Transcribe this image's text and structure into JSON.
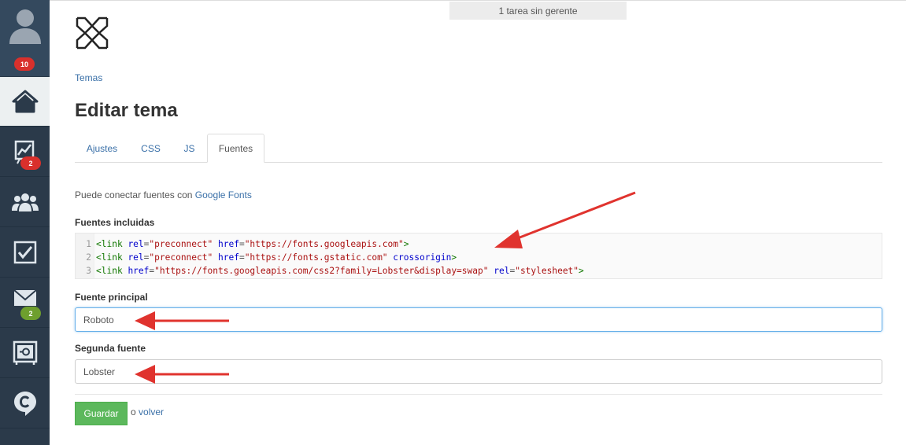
{
  "sidebar": {
    "user_badge": "10",
    "items": [
      {
        "name": "home-icon",
        "active": true
      },
      {
        "name": "chart-icon",
        "badge": "2",
        "badge_color": "#d9302c"
      },
      {
        "name": "group-icon"
      },
      {
        "name": "checkbox-icon"
      },
      {
        "name": "mail-icon",
        "badge": "2",
        "badge_color": "#6e9f2e"
      },
      {
        "name": "safe-icon"
      },
      {
        "name": "chat-icon"
      }
    ]
  },
  "notice": "1 tarea sin gerente",
  "breadcrumb": "Temas",
  "page_title": "Editar tema",
  "tabs": [
    {
      "label": "Ajustes"
    },
    {
      "label": "CSS"
    },
    {
      "label": "JS"
    },
    {
      "label": "Fuentes",
      "active": true
    }
  ],
  "hint": {
    "text": "Puede conectar fuentes con ",
    "link": "Google Fonts"
  },
  "included_fonts": {
    "label": "Fuentes incluidas",
    "lines": [
      {
        "num": "1",
        "attr1": "rel",
        "val1": "\"preconnect\"",
        "attr2": "href",
        "val2": "\"https://fonts.googleapis.com\"",
        "extra": ""
      },
      {
        "num": "2",
        "attr1": "rel",
        "val1": "\"preconnect\"",
        "attr2": "href",
        "val2": "\"https://fonts.gstatic.com\"",
        "extra": "crossorigin"
      },
      {
        "num": "3",
        "attr1": "href",
        "val1": "\"https://fonts.googleapis.com/css2?family=Lobster&display=swap\"",
        "attr2": "rel",
        "val2": "\"stylesheet\"",
        "extra": ""
      }
    ]
  },
  "main_font": {
    "label": "Fuente principal",
    "value": "Roboto"
  },
  "second_font": {
    "label": "Segunda fuente",
    "value": "Lobster"
  },
  "actions": {
    "save": "Guardar",
    "or": "o ",
    "back": "volver"
  },
  "colors": {
    "sidebar": "#2b3a4a",
    "link": "#3a70a8",
    "save": "#5cb85c",
    "annotation": "#e0332e"
  }
}
